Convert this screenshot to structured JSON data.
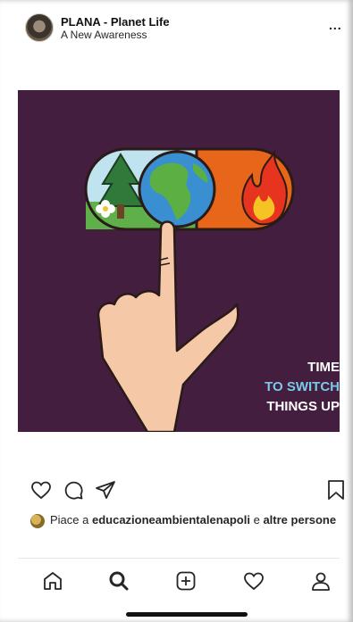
{
  "header": {
    "username": "PLANA - Planet Life",
    "subtitle": "A New Awareness",
    "more": "..."
  },
  "post": {
    "caption_lines": [
      "TIME",
      "TO SWITCH",
      "THINGS UP"
    ],
    "colors": {
      "background": "#441e3e",
      "line1": "#ffffff",
      "line2": "#7cc8e8",
      "line3": "#ffffff",
      "switch_right": "#e8661a"
    }
  },
  "actions": {
    "icons": [
      "heart-icon",
      "comment-icon",
      "share-icon",
      "bookmark-icon"
    ]
  },
  "likes": {
    "prefix": "Piace a ",
    "user": "educazioneambientalenapoli",
    "middle": " e ",
    "suffix": "altre persone"
  },
  "tabbar": {
    "icons": [
      "home-icon",
      "search-icon",
      "add-post-icon",
      "activity-heart-icon",
      "profile-icon"
    ]
  }
}
